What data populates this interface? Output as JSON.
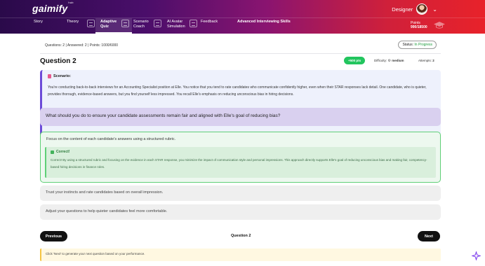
{
  "header": {
    "logo": "gaimify",
    "logo_sup": "hub",
    "user_name": "Designer",
    "chevron": "⌄"
  },
  "nav": {
    "items": [
      {
        "label": "Story"
      },
      {
        "label": "Theory"
      },
      {
        "label": "Adaptive\nQuiz"
      },
      {
        "label": "Scenario\nCoach"
      },
      {
        "label": "AI Avatar\nSimulation"
      },
      {
        "label": "Feedback"
      },
      {
        "label": "Advanced Interviewing Skills"
      }
    ],
    "points_label": "Points",
    "points_value": "990/18500"
  },
  "quiz": {
    "meta": "Questions: 2 | Answered: 2 | Points: 1000/6000",
    "status_label": "Status:",
    "status_value": "In Progress",
    "title": "Question 2",
    "points_badge": "+500 pts",
    "difficulty_label": "Difficulty:",
    "difficulty_value": "medium",
    "attempts_label": "Attempts:",
    "attempts_value": "2"
  },
  "scenario": {
    "heading": "Scenario:",
    "text": "You're conducting back-to-back interviews for an Accounting Specialist position at Elle. You notice that you tend to rate candidates who communicate confidently higher, even when their STAR responses lack detail. One candidate, who is quieter, provides thorough, evidence-based answers, but you find yourself less impressed. You recall Elle's emphasis on reducing unconscious bias in hiring decisions."
  },
  "question": {
    "text": "What should you do to ensure your candidate assessments remain fair and aligned with Elle's goal of reducing bias?"
  },
  "options": [
    {
      "text": "Focus on the content of each candidate's answers using a structured rubric.",
      "correct": true,
      "feedback_title": "Correct!",
      "feedback_text": "Correct! By using a structured rubric and focusing on the evidence in each STAR response, you minimize the impact of communication style and personal impressions. This approach directly supports Elle's goal of reducing unconscious bias and making fair, competency-based hiring decisions in finance roles."
    },
    {
      "text": "Trust your instincts and rate candidates based on overall impression."
    },
    {
      "text": "Adjust your questions to help quieter candidates feel more comfortable."
    }
  ],
  "pager": {
    "previous_label": "Previous",
    "current": "Question 2",
    "next_label": "Next"
  },
  "hint": {
    "text": "Click 'Next' to generate your next question based on your performance."
  },
  "colors": {
    "accent_purple": "#6d4bd8",
    "correct_green": "#22c55e",
    "question_bg": "#d9d0ef"
  }
}
